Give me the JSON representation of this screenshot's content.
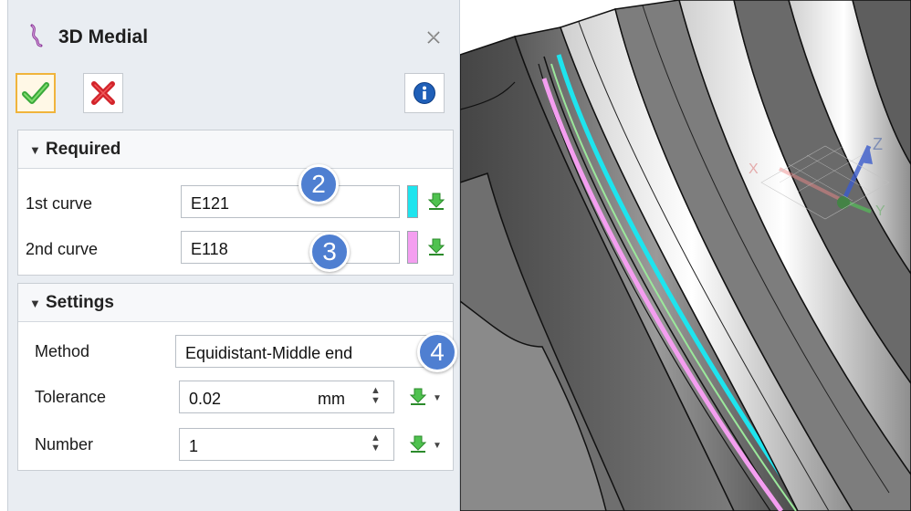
{
  "dialog": {
    "title": "3D Medial",
    "title_icon": "medial-curve-icon",
    "close_icon": "close-icon"
  },
  "toolbar": {
    "ok_icon": "checkmark-icon",
    "cancel_icon": "red-x-icon",
    "info_icon": "info-icon"
  },
  "required": {
    "header": "Required",
    "first_curve": {
      "label": "1st curve",
      "value": "E121",
      "swatch_color": "#1ee4ee"
    },
    "second_curve": {
      "label": "2nd curve",
      "value": "E118",
      "swatch_color": "#f49ef0"
    }
  },
  "settings": {
    "header": "Settings",
    "method": {
      "label": "Method",
      "value": "Equidistant-Middle end"
    },
    "tolerance": {
      "label": "Tolerance",
      "value": "0.02",
      "unit": "mm"
    },
    "number": {
      "label": "Number",
      "value": "1"
    }
  },
  "callouts": [
    "2",
    "3",
    "4"
  ],
  "colors": {
    "accent_badge": "#4f7fd1",
    "curve_cyan": "#1ee4ee",
    "curve_pink": "#f49ef0",
    "curve_green": "#9be89b"
  }
}
